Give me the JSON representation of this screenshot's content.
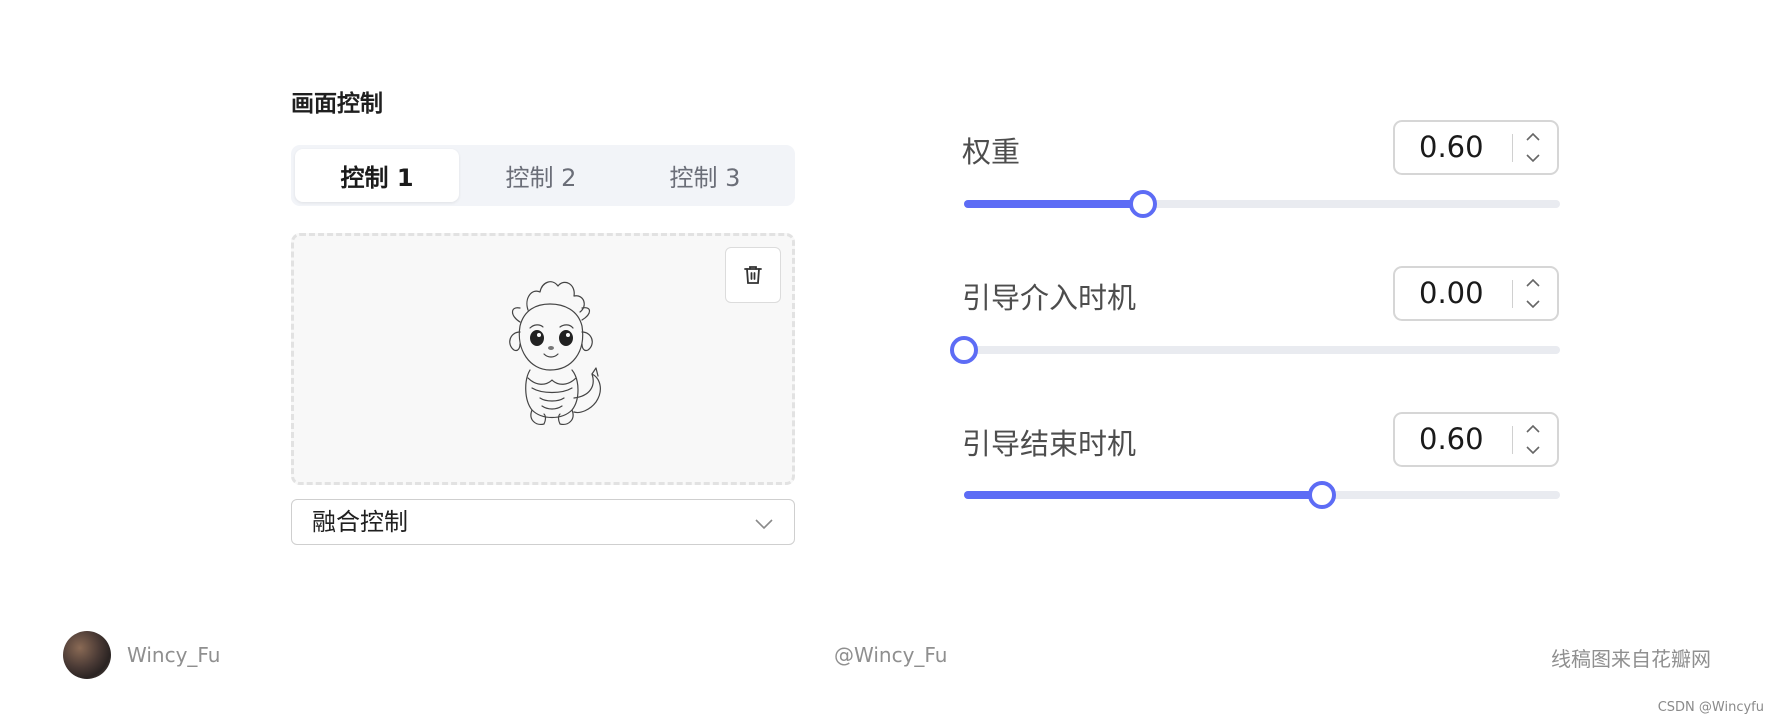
{
  "panel": {
    "title": "画面控制",
    "tabs": [
      {
        "label": "控制 1",
        "active": true
      },
      {
        "label": "控制 2",
        "active": false
      },
      {
        "label": "控制 3",
        "active": false
      }
    ],
    "image": {
      "icon": "dragon-sketch-image",
      "delete_icon": "trash-icon"
    },
    "mode_select": {
      "value": "融合控制",
      "icon": "chevron-down-icon"
    }
  },
  "params": [
    {
      "label": "权重",
      "value": "0.60",
      "slider_fraction": 0.3
    },
    {
      "label": "引导介入时机",
      "value": "0.00",
      "slider_fraction": 0.0
    },
    {
      "label": "引导结束时机",
      "value": "0.60",
      "slider_fraction": 0.6
    }
  ],
  "footer": {
    "username": "Wincy_Fu",
    "handle": "@Wincy_Fu",
    "credit": "线稿图来自花瓣网",
    "watermark": "CSDN @Wincyfu"
  },
  "colors": {
    "accent": "#5d6cf5",
    "track": "#e9ebf0",
    "tab_bg": "#f2f4f8"
  }
}
